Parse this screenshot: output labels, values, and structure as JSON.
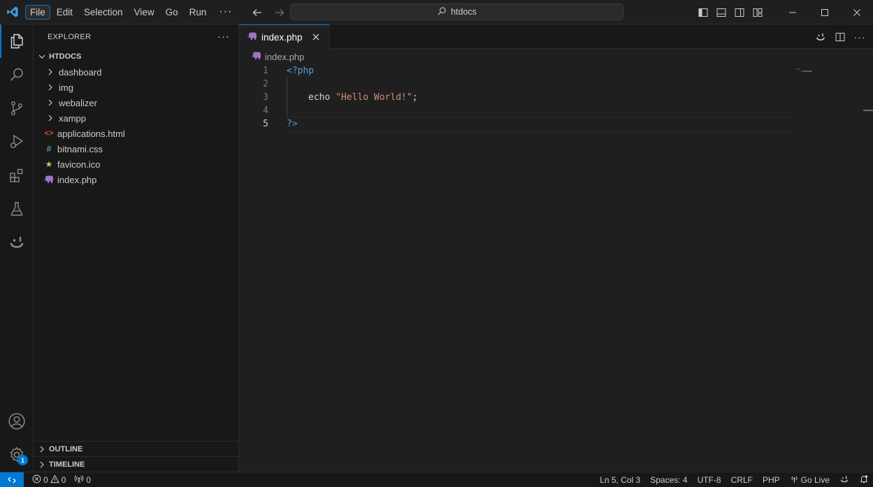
{
  "titlebar": {
    "menus": [
      "File",
      "Edit",
      "Selection",
      "View",
      "Go",
      "Run"
    ],
    "active_menu_index": 0,
    "more_label": "···",
    "command_center_text": "htdocs"
  },
  "activity_bar": {
    "items": [
      "explorer-icon",
      "search-icon",
      "source-control-icon",
      "run-debug-icon",
      "extensions-icon",
      "testing-icon",
      "copilot-icon"
    ],
    "bottom_items": [
      "accounts-icon",
      "manage-gear-icon"
    ],
    "manage_badge": "1"
  },
  "sidebar": {
    "title": "EXPLORER",
    "more_label": "···",
    "folder_name": "HTDOCS",
    "tree": [
      {
        "name": "dashboard",
        "type": "folder"
      },
      {
        "name": "img",
        "type": "folder"
      },
      {
        "name": "webalizer",
        "type": "folder"
      },
      {
        "name": "xampp",
        "type": "folder"
      },
      {
        "name": "applications.html",
        "type": "html",
        "icon": "<>",
        "color": "#e44d26"
      },
      {
        "name": "bitnami.css",
        "type": "css",
        "icon": "#",
        "color": "#519aba"
      },
      {
        "name": "favicon.ico",
        "type": "ico",
        "icon": "★",
        "color": "#cbcb41"
      },
      {
        "name": "index.php",
        "type": "php",
        "icon": "php-elephant-icon",
        "color": "#a074c4"
      }
    ],
    "outline_label": "OUTLINE",
    "timeline_label": "TIMELINE"
  },
  "editor": {
    "tab_label": "index.php",
    "breadcrumb": "index.php",
    "line_numbers": [
      "1",
      "2",
      "3",
      "4",
      "5"
    ],
    "current_line": 5,
    "code": {
      "open_tag": "<?php",
      "echo_kw": "echo",
      "string": "\"Hello World!\"",
      "semicolon": ";",
      "close_tag": "?>"
    }
  },
  "statusbar": {
    "errors": "0",
    "warnings": "0",
    "ports": "0",
    "position": "Ln 5, Col 3",
    "spaces": "Spaces: 4",
    "encoding": "UTF-8",
    "eol": "CRLF",
    "language": "PHP",
    "go_live": "Go Live"
  },
  "colors": {
    "accent": "#0078d4",
    "php_icon": "#a074c4",
    "keyword_tag": "#569cd6",
    "string": "#ce9178"
  }
}
